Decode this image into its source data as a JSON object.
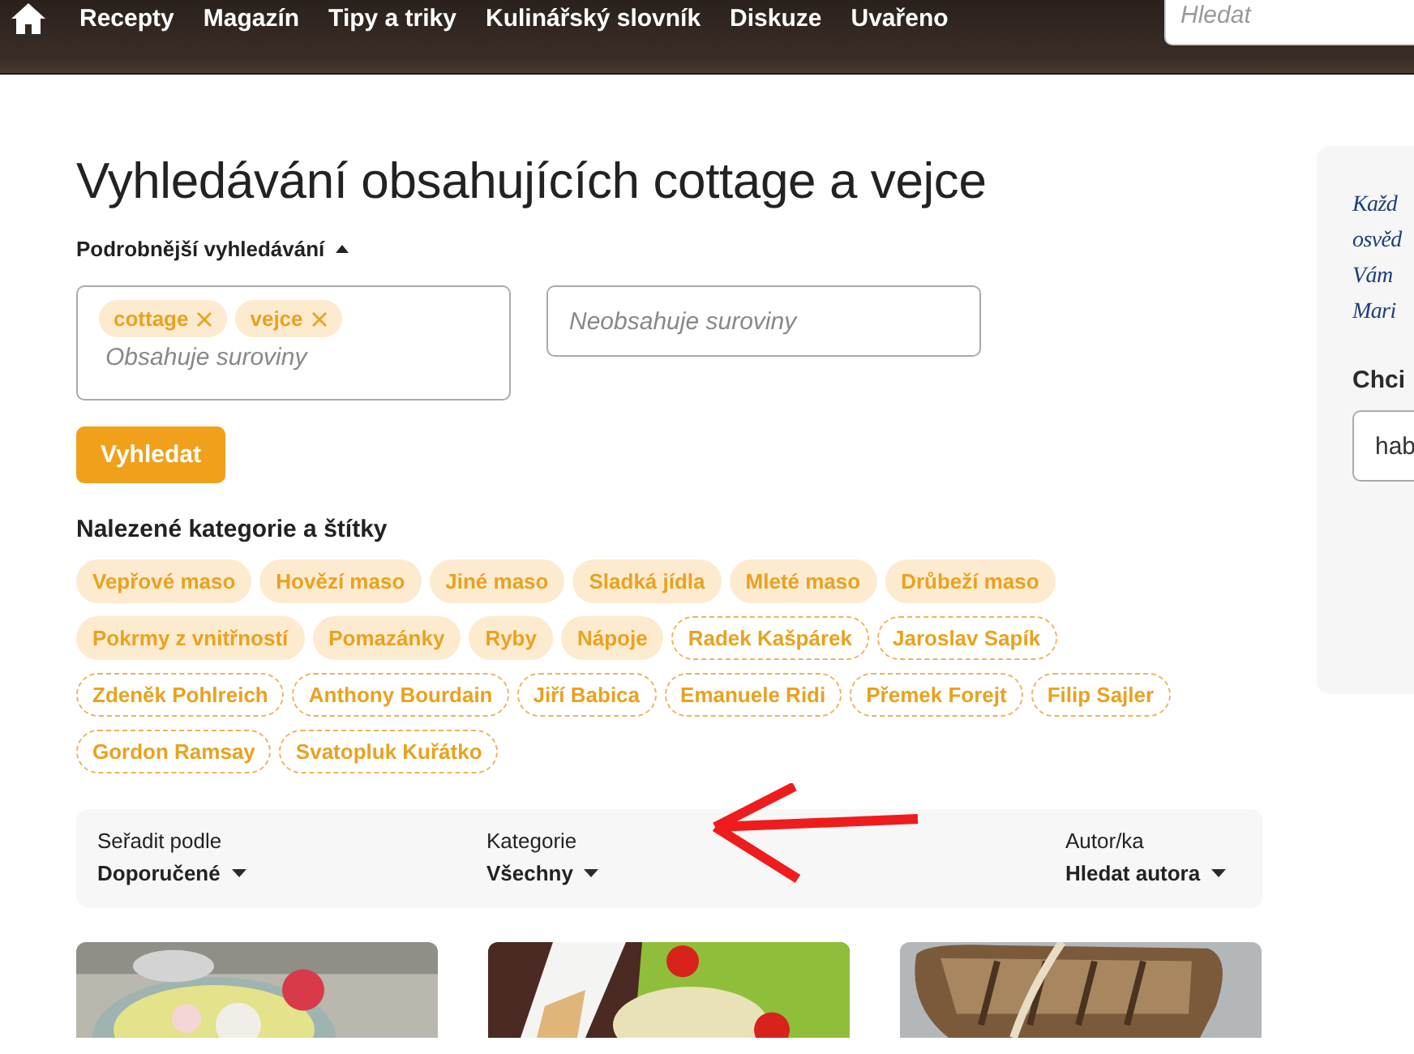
{
  "header": {
    "nav": [
      "Recepty",
      "Magazín",
      "Tipy a triky",
      "Kulinářský slovník",
      "Diskuze",
      "Uvařeno"
    ],
    "search": {
      "placeholder": "Hledat"
    }
  },
  "title": "Vyhledávání obsahujících cottage a vejce",
  "advanced_toggle": {
    "label": "Podrobnější vyhledávání",
    "expanded": true
  },
  "include_field": {
    "chips": [
      "cottage",
      "vejce"
    ],
    "placeholder": "Obsahuje suroviny"
  },
  "exclude_field": {
    "placeholder": "Neobsahuje suroviny"
  },
  "search_button": "Vyhledat",
  "found_heading": "Nalezené kategorie a štítky",
  "tags": [
    {
      "label": "Vepřové maso",
      "kind": "category"
    },
    {
      "label": "Hovězí maso",
      "kind": "category"
    },
    {
      "label": "Jiné maso",
      "kind": "category"
    },
    {
      "label": "Sladká jídla",
      "kind": "category"
    },
    {
      "label": "Mleté maso",
      "kind": "category"
    },
    {
      "label": "Drůbeží maso",
      "kind": "category"
    },
    {
      "label": "Pokrmy z vnitřností",
      "kind": "category"
    },
    {
      "label": "Pomazánky",
      "kind": "category"
    },
    {
      "label": "Ryby",
      "kind": "category"
    },
    {
      "label": "Nápoje",
      "kind": "category"
    },
    {
      "label": "Radek Kašpárek",
      "kind": "author"
    },
    {
      "label": "Jaroslav Sapík",
      "kind": "author"
    },
    {
      "label": "Zdeněk Pohlreich",
      "kind": "author"
    },
    {
      "label": "Anthony Bourdain",
      "kind": "author"
    },
    {
      "label": "Jiří Babica",
      "kind": "author"
    },
    {
      "label": "Emanuele Ridi",
      "kind": "author"
    },
    {
      "label": "Přemek Forejt",
      "kind": "author"
    },
    {
      "label": "Filip Sajler",
      "kind": "author"
    },
    {
      "label": "Gordon Ramsay",
      "kind": "author"
    },
    {
      "label": "Svatopluk Kuřátko",
      "kind": "author"
    }
  ],
  "filters": [
    {
      "label": "Seřadit podle",
      "value": "Doporučené"
    },
    {
      "label": "Kategorie",
      "value": "Všechny"
    },
    {
      "label": "Autor/ka",
      "value": "Hledat autora"
    }
  ],
  "sidebar": {
    "note_lines": [
      "Každ",
      "osvěd",
      "Vám",
      "Mari"
    ],
    "heading": "Chci",
    "field_value": "hab"
  }
}
